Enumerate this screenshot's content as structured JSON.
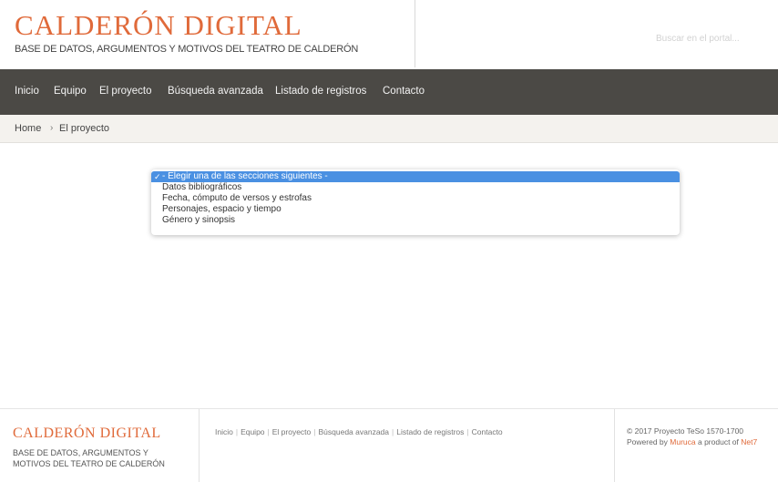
{
  "header": {
    "title": "CALDERÓN DIGITAL",
    "subtitle": "BASE DE DATOS, ARGUMENTOS Y MOTIVOS DEL TEATRO DE CALDERÓN",
    "search_placeholder": "Buscar en el portal..."
  },
  "nav": {
    "items": [
      "Inicio",
      "Equipo",
      "El proyecto",
      "Búsqueda avanzada",
      "Listado de registros",
      "Contacto"
    ]
  },
  "breadcrumb": {
    "home": "Home",
    "separator": "›",
    "current": "El proyecto"
  },
  "select": {
    "check_mark": "✓",
    "options": [
      "- Elegir una de las secciones siguientes -",
      "Datos bibliográficos",
      "Fecha, cómputo de versos y estrofas",
      "Personajes, espacio y tiempo",
      "Género y sinopsis"
    ],
    "selected_index": 0
  },
  "footer": {
    "title": "CALDERÓN DIGITAL",
    "subtitle": "BASE DE DATOS, ARGUMENTOS Y MOTIVOS DEL TEATRO DE CALDERÓN",
    "links": [
      "Inicio",
      "Equipo",
      "El proyecto",
      "Búsqueda avanzada",
      "Listado de registros",
      "Contacto"
    ],
    "copyright": "© 2017 Proyecto TeSo 1570-1700",
    "powered_prefix": "Powered by",
    "powered_link": "Muruca",
    "powered_middle": "a product of",
    "powered_company": "Net7"
  },
  "colors": {
    "accent": "#e06a3a",
    "nav_bg": "#4b4945",
    "breadcrumb_bg": "#f4f2ee",
    "selected_bg": "#4a90e2"
  }
}
